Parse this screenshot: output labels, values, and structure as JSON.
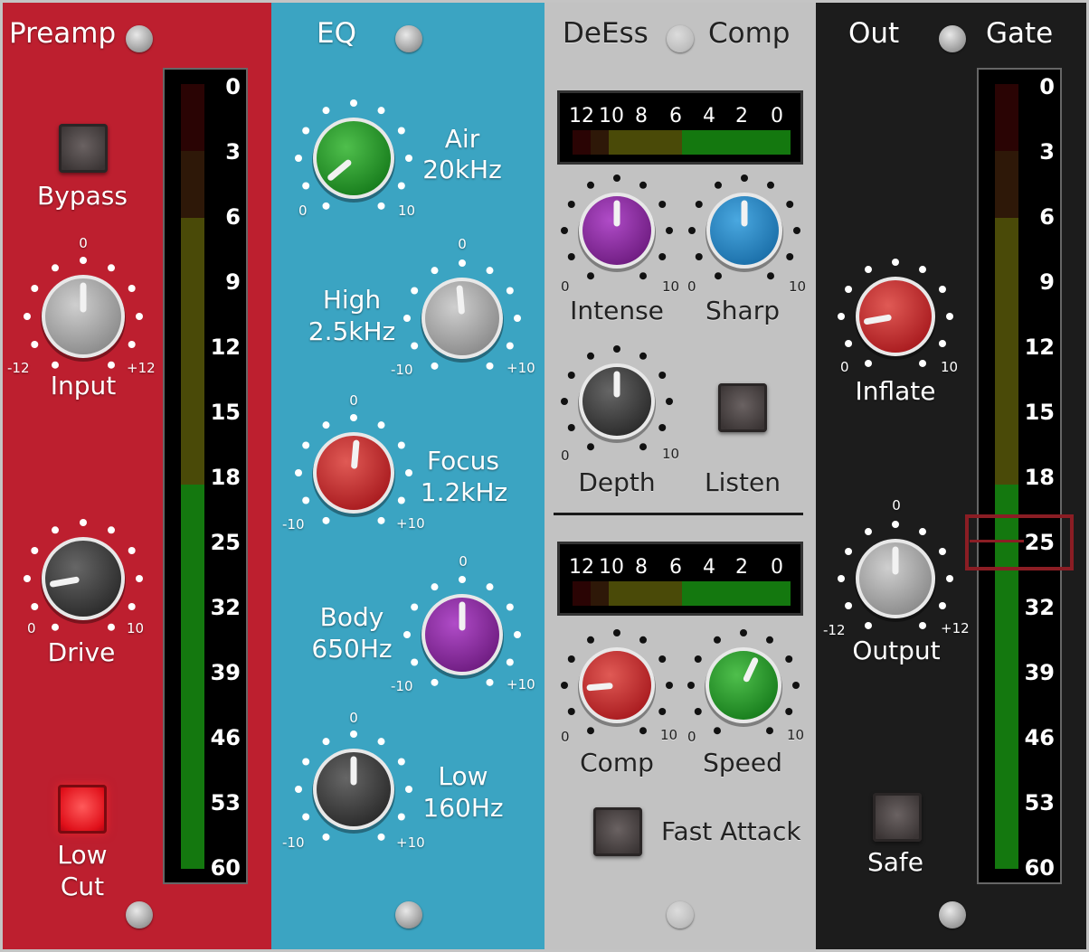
{
  "preamp": {
    "title": "Preamp",
    "bypass_label": "Bypass",
    "input_label": "Input",
    "input_min": "-12",
    "input_max": "+12",
    "input_top": "0",
    "drive_label": "Drive",
    "drive_min": "0",
    "drive_max": "10",
    "lowcut_line1": "Low",
    "lowcut_line2": "Cut",
    "meter_scale": [
      "0",
      "3",
      "6",
      "9",
      "12",
      "15",
      "18",
      "25",
      "32",
      "39",
      "46",
      "53",
      "60"
    ]
  },
  "eq": {
    "title": "EQ",
    "air_label1": "Air",
    "air_label2": "20kHz",
    "air_min": "0",
    "air_max": "10",
    "high_label1": "High",
    "high_label2": "2.5kHz",
    "high_min": "-10",
    "high_max": "+10",
    "high_top": "0",
    "focus_label1": "Focus",
    "focus_label2": "1.2kHz",
    "focus_min": "-10",
    "focus_max": "+10",
    "focus_top": "0",
    "body_label1": "Body",
    "body_label2": "650Hz",
    "body_min": "-10",
    "body_max": "+10",
    "body_top": "0",
    "low_label1": "Low",
    "low_label2": "160Hz",
    "low_min": "-10",
    "low_max": "+10",
    "low_top": "0"
  },
  "dynamics": {
    "deess_title": "DeEss",
    "comp_title": "Comp",
    "meter_scale": [
      "12",
      "10",
      "8",
      "6",
      "4",
      "2",
      "0"
    ],
    "intense_label": "Intense",
    "sharp_label": "Sharp",
    "depth_label": "Depth",
    "listen_label": "Listen",
    "comp_label": "Comp",
    "speed_label": "Speed",
    "fast_attack_label": "Fast Attack",
    "knob_min": "0",
    "knob_max": "10"
  },
  "output": {
    "out_title": "Out",
    "gate_title": "Gate",
    "inflate_label": "Inflate",
    "inflate_min": "0",
    "inflate_max": "10",
    "output_label": "Output",
    "output_min": "-12",
    "output_max": "+12",
    "output_top": "0",
    "safe_label": "Safe",
    "meter_scale": [
      "0",
      "3",
      "6",
      "9",
      "12",
      "15",
      "18",
      "25",
      "32",
      "39",
      "46",
      "53",
      "60"
    ],
    "gate_threshold": "25"
  },
  "colors": {
    "preamp_bg": "#bd1f2f",
    "eq_bg": "#3ba4c2",
    "dyn_bg": "#c2c2c2",
    "out_bg": "#1c1c1c",
    "meter_green": "#14780f",
    "meter_olive": "#4a4a08",
    "meter_brown": "#2e1808",
    "meter_red": "#2a0404",
    "highlight": "#8b1d24"
  }
}
